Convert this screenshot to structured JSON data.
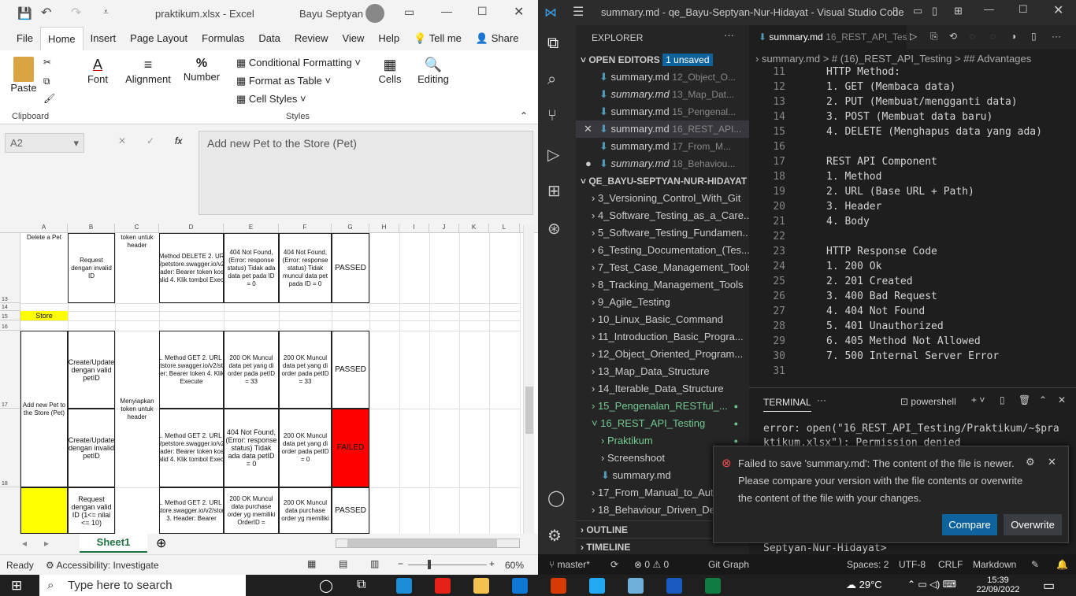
{
  "excel": {
    "filename": "praktikum.xlsx",
    "separator": "-",
    "app": "Excel",
    "user": "Bayu Septyan",
    "tabs": [
      "File",
      "Home",
      "Insert",
      "Page Layout",
      "Formulas",
      "Data",
      "Review",
      "View",
      "Help"
    ],
    "tell_me": "Tell me",
    "share": "Share",
    "ribbon": {
      "paste": "Paste",
      "clipboard": "Clipboard",
      "font": "Font",
      "alignment": "Alignment",
      "number": "Number",
      "percent": "%",
      "cond_format": "Conditional Formatting",
      "format_table": "Format as Table",
      "cell_styles": "Cell Styles",
      "styles": "Styles",
      "cells": "Cells",
      "editing": "Editing"
    },
    "name_box": "A2",
    "fx": "fx",
    "formula": "Add new Pet to the Store (Pet)",
    "columns": [
      "A",
      "B",
      "C",
      "D",
      "E",
      "F",
      "G",
      "H",
      "I",
      "J",
      "K",
      "L"
    ],
    "rows": [
      "13",
      "14",
      "15",
      "16",
      "17",
      "18"
    ],
    "cells": {
      "a12": "Delete a Pet",
      "c12": "token untuk header",
      "b13": "Request dengan invalid ID",
      "d13": "1. Method DELETE 2. URL : https://petstore.swagger.io/v2/pet/0 3. Header: Bearer token kosong / invalid 4. Klik tombol Execute",
      "e13": "404 Not Found, (Error: response status) Tidak ada data pet pada ID = 0",
      "f13": "404 Not Found, (Error: response status) Tidak muncul data pet pada ID = 0",
      "g13": "PASSED",
      "a15": "Store",
      "a17": "Add new Pet to the Store (Pet)",
      "c17": "Menyiapkan token untuk header",
      "b17": "Create/Update dengan valid petID",
      "d17": "1. Method GET 2. URL : https://petstore.swagger.io/v2/store/order 3. Header: Bearer token 4. Klik tombol Execute",
      "e17": "200 OK Muncul data pet yang di order pada petID = 33",
      "f17": "200 OK Muncul data pet yang di order pada petID = 33",
      "g17": "PASSED",
      "b18": "Create/Update dengan invalid petID",
      "d18": "1. Method GET 2. URL : https://petstore.swagger.io/v2/pet/0 3. Header: Bearer token kosong / invalid 4. Klik tombol Execute",
      "e18": "404 Not Found, (Error: response status) Tidak ada data petID = 0",
      "f18": "200 OK Muncul data pet yang di order pada petID = 0",
      "g18": "FAILED",
      "b19": "Request dengan valid ID (1<= nilai <= 10)",
      "d19": "1. Method GET 2. URL : https://petstore.swagger.io/v2/store/order/10 3. Header: Bearer",
      "e19": "200 OK Muncul data purchase order yg memiliki OrderID =",
      "f19": "200 OK Muncul data purchase order yg memiliki",
      "g19": "PASSED"
    },
    "sheet_tab": "Sheet1",
    "status_ready": "Ready",
    "accessibility": "Accessibility: Investigate",
    "zoom": "60%"
  },
  "vscode": {
    "title": "summary.md - qe_Bayu-Septyan-Nur-Hidayat - Visual Studio Code",
    "explorer": "EXPLORER",
    "open_editors": "OPEN EDITORS",
    "unsaved": "1 unsaved",
    "editors": [
      {
        "name": "summary.md",
        "dir": "12_Object_O..."
      },
      {
        "name": "summary.md",
        "dir": "13_Map_Dat..."
      },
      {
        "name": "summary.md",
        "dir": "15_Pengenal..."
      },
      {
        "name": "summary.md",
        "dir": "16_REST_API..."
      },
      {
        "name": "summary.md",
        "dir": "17_From_M..."
      },
      {
        "name": "summary.md",
        "dir": "18_Behaviou..."
      }
    ],
    "workspace": "QE_BAYU-SEPTYAN-NUR-HIDAYAT",
    "folders": [
      "3_Versioning_Control_With_Git",
      "4_Software_Testing_as_a_Care...",
      "5_Software_Testing_Fundamen...",
      "6_Testing_Documentation_(Tes...",
      "7_Test_Case_Management_Tools",
      "8_Tracking_Management_Tools",
      "9_Agile_Testing",
      "10_Linux_Basic_Command",
      "11_Introduction_Basic_Progra...",
      "12_Object_Oriented_Program...",
      "13_Map_Data_Structure",
      "14_Iterable_Data_Structure",
      "15_Pengenalan_RESTful_...",
      "16_REST_API_Testing",
      "Praktikum",
      "Screenshoot",
      "summary.md",
      "17_From_Manual_to_Aut",
      "18_Behaviour_Driven_De"
    ],
    "outline": "OUTLINE",
    "timeline": "TIMELINE",
    "tab_name": "summary.md",
    "tab_dir": "16_REST_API_Tes",
    "breadcrumb": "summary.md  > # (16)_REST_API_Testing  > ## Advantages",
    "lines": [
      {
        "n": "11",
        "t": "HTTP Method:"
      },
      {
        "n": "12",
        "t": "1. GET (Membaca data)"
      },
      {
        "n": "13",
        "t": "2. PUT (Membuat/mengganti data)"
      },
      {
        "n": "14",
        "t": "3. POST (Membuat data baru)"
      },
      {
        "n": "15",
        "t": "4. DELETE (Menghapus data yang ada)"
      },
      {
        "n": "16",
        "t": ""
      },
      {
        "n": "17",
        "t": "REST API Component"
      },
      {
        "n": "18",
        "t": "1. Method"
      },
      {
        "n": "19",
        "t": "2. URL (Base URL + Path)"
      },
      {
        "n": "20",
        "t": "3. Header"
      },
      {
        "n": "21",
        "t": "4. Body"
      },
      {
        "n": "22",
        "t": ""
      },
      {
        "n": "23",
        "t": "HTTP Response Code"
      },
      {
        "n": "24",
        "t": "1. 200 Ok"
      },
      {
        "n": "25",
        "t": "2. 201 Created"
      },
      {
        "n": "26",
        "t": "3. 400 Bad Request"
      },
      {
        "n": "27",
        "t": "4. 404 Not Found"
      },
      {
        "n": "28",
        "t": "5. 401 Unauthorized"
      },
      {
        "n": "29",
        "t": "6. 405 Method Not Allowed"
      },
      {
        "n": "30",
        "t": "7. 500 Internal Server Error"
      },
      {
        "n": "31",
        "t": ""
      }
    ],
    "terminal": "TERMINAL",
    "shell": "powershell",
    "term_line1": "error: open(\"16_REST_API_Testing/Praktikum/~$pra",
    "term_line2": "ktikum.xlsx\"): Permission denied",
    "term_prompt": "Septyan-Nur-Hidayat>",
    "toast_msg": "Failed to save 'summary.md': The content of the file is newer. Please compare your version with the file contents or overwrite the content of the file with your changes.",
    "compare": "Compare",
    "overwrite": "Overwrite",
    "status": {
      "branch": "master*",
      "problems": "⊗ 0 ⚠ 0",
      "git_graph": "Git Graph",
      "spaces": "Spaces: 2",
      "encoding": "UTF-8",
      "eol": "CRLF",
      "lang": "Markdown"
    }
  },
  "taskbar": {
    "search": "Type here to search",
    "weather": "29°C",
    "time": "15:39",
    "date": "22/09/2022"
  }
}
